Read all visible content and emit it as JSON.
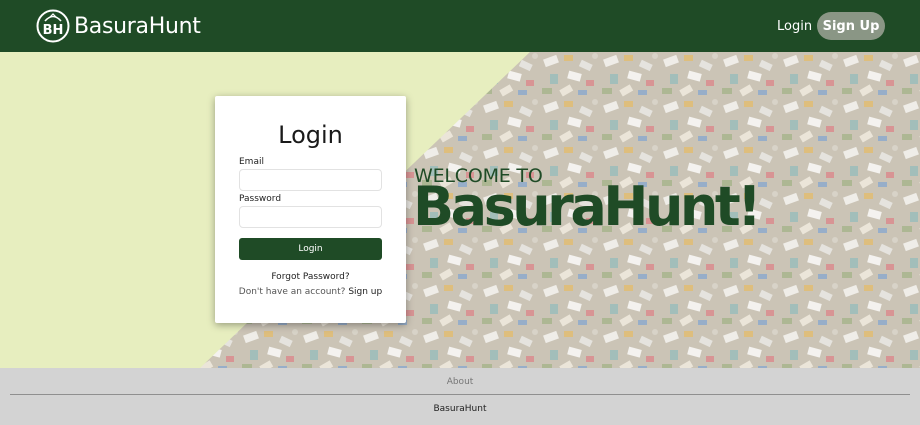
{
  "navbar": {
    "brand_name": "BasuraHunt",
    "logo_letters": "BH",
    "login_label": "Login",
    "signup_label": "Sign Up"
  },
  "hero": {
    "welcome_line": "WELCOME TO",
    "welcome_title": "BasuraHunt!"
  },
  "login_card": {
    "title": "Login",
    "email_label": "Email",
    "email_value": "",
    "password_label": "Password",
    "password_value": "",
    "submit_label": "Login",
    "forgot_label": "Forgot Password?",
    "no_account_text": "Don't have an account?",
    "signup_link": "Sign up"
  },
  "footer": {
    "about_label": "About",
    "brand_label": "BasuraHunt"
  },
  "colors": {
    "primary": "#1f4b26",
    "hero_background": "#e7eebf",
    "signup_button": "#8a9685",
    "footer_background": "#d3d3d3"
  }
}
